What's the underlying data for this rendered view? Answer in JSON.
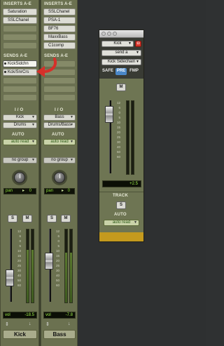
{
  "mixer": {
    "strips": [
      {
        "inserts_label": "INSERTS A-E",
        "inserts": [
          "Saturation",
          "SSLChanel"
        ],
        "sends_label": "SENDS A-E",
        "sends": [
          "KickSidchn",
          "Kck/SnrCrs"
        ],
        "io_label": "I / O",
        "input": "Kick",
        "output": "Drums",
        "auto_label": "AUTO",
        "auto_mode": "auto read",
        "group": "no group",
        "pan_label": "pan",
        "pan_value": "0",
        "solo": "S",
        "mute": "M",
        "vol_label": "vol",
        "vol_value": "-18.5",
        "name": "Kick"
      },
      {
        "inserts_label": "INSERTS A-E",
        "inserts": [
          "SSLChanel",
          "PSA-1",
          "BF76",
          "MaxxBass",
          "C1comp"
        ],
        "sends_label": "SENDS A-E",
        "sends": [],
        "io_label": "I / O",
        "input": "Bass",
        "output": "Drums/Bass",
        "auto_label": "AUTO",
        "auto_mode": "auto read",
        "group": "no group",
        "pan_label": "pan",
        "pan_value": "0",
        "solo": "S",
        "mute": "M",
        "vol_label": "vol",
        "vol_value": "-7.8",
        "name": "Bass"
      }
    ],
    "meter_scale": [
      "12",
      "6",
      "0",
      "5",
      "10",
      "15",
      "20",
      "25",
      "30",
      "40",
      "50",
      "60"
    ],
    "fader_scale": [
      "12",
      "6",
      "0",
      "5",
      "10",
      "15",
      "20",
      "25",
      "30",
      "40",
      "50",
      "60"
    ]
  },
  "send_window": {
    "track": "Kick",
    "send": "send a",
    "destination": "Kick Sidechain",
    "safe": "SAFE",
    "pre": "PRE",
    "fmp": "FMP",
    "mute": "M",
    "fader_scale": [
      "12",
      "6",
      "0",
      "5",
      "10",
      "15",
      "20",
      "25",
      "30",
      "40",
      "50",
      "60"
    ],
    "level_value": "+2.5",
    "track_label": "TRACK",
    "solo": "S",
    "auto_label": "AUTO",
    "auto_mode": "auto read"
  },
  "colors": {
    "strip_bg": "#6b7150",
    "auto_text": "#2c5a18",
    "lcd_text": "#8fe03a",
    "arrow": "#d6302a",
    "window_footer": "#c49a1e"
  },
  "icons": {
    "arrow": "red-curved-arrow",
    "close": "close-icon"
  }
}
